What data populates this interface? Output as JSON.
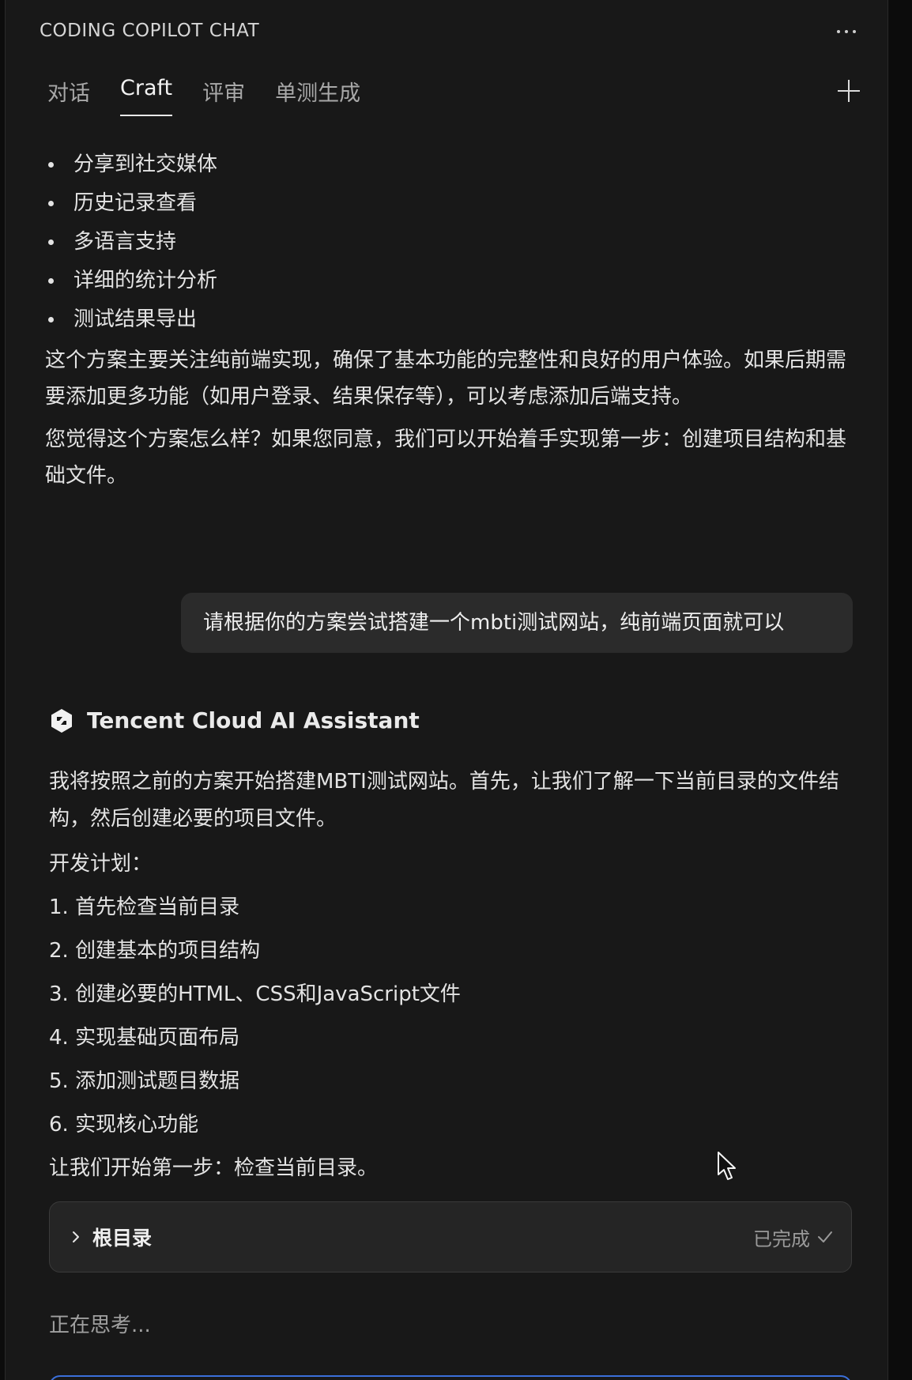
{
  "panel": {
    "title": "CODING COPILOT CHAT",
    "more_icon": "ellipsis-icon",
    "tabs": [
      {
        "label": "对话",
        "active": false
      },
      {
        "label": "Craft",
        "active": true
      },
      {
        "label": "评审",
        "active": false
      },
      {
        "label": "单测生成",
        "active": false
      }
    ],
    "new_chat_icon": "plus-icon"
  },
  "previous_message": {
    "bullets": [
      "分享到社交媒体",
      "历史记录查看",
      "多语言支持",
      "详细的统计分析",
      "测试结果导出"
    ],
    "summary": "这个方案主要关注纯前端实现，确保了基本功能的完整性和良好的用户体验。如果后期需要添加更多功能（如用户登录、结果保存等），可以考虑添加后端支持。",
    "question": "您觉得这个方案怎么样？如果您同意，我们可以开始着手实现第一步：创建项目结构和基础文件。"
  },
  "user_message": "请根据你的方案尝试搭建一个mbti测试网站，纯前端页面就可以",
  "assistant": {
    "name": "Tencent Cloud AI Assistant",
    "logo_icon": "tencent-cloud-logo-icon",
    "intro": "我将按照之前的方案开始搭建MBTI测试网站。首先，让我们了解一下当前目录的文件结构，然后创建必要的项目文件。",
    "plan_heading": "开发计划：",
    "plan_items": [
      "1. 首先检查当前目录",
      "2. 创建基本的项目结构",
      "3. 创建必要的HTML、CSS和JavaScript文件",
      "4. 实现基础页面布局",
      "5. 添加测试题目数据",
      "6. 实现核心功能"
    ],
    "next_step": "让我们开始第一步：检查当前目录。"
  },
  "tool_card": {
    "label": "根目录",
    "status": "已完成",
    "expand_icon": "chevron-right-icon",
    "status_icon": "check-icon"
  },
  "thinking_text": "正在思考..."
}
